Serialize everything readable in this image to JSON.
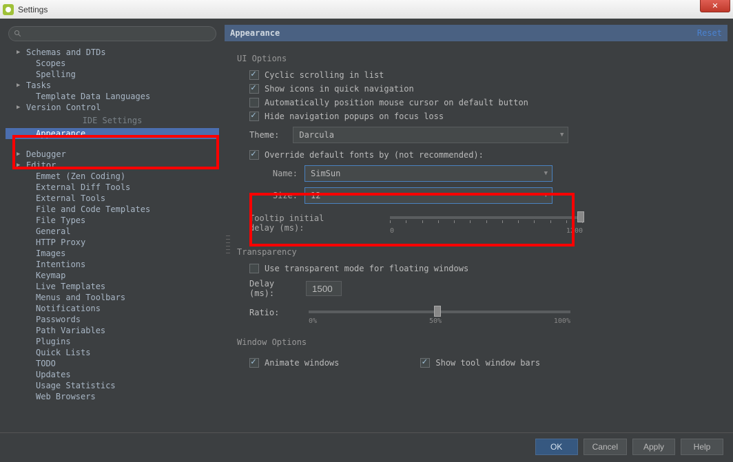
{
  "window": {
    "title": "Settings"
  },
  "sidebar": {
    "search_placeholder": "",
    "items_top": [
      {
        "label": "Schemas and DTDs",
        "expandable": true,
        "level": 0
      },
      {
        "label": "Scopes",
        "expandable": false,
        "level": 1
      },
      {
        "label": "Spelling",
        "expandable": false,
        "level": 1
      },
      {
        "label": "Tasks",
        "expandable": true,
        "level": 0
      },
      {
        "label": "Template Data Languages",
        "expandable": false,
        "level": 1
      },
      {
        "label": "Version Control",
        "expandable": true,
        "level": 0
      }
    ],
    "ide_section_label": "IDE Settings",
    "selected_item": "Appearance",
    "items_bottom": [
      {
        "label": "Debugger",
        "expandable": true,
        "level": 0
      },
      {
        "label": "Editor",
        "expandable": true,
        "level": 0
      },
      {
        "label": "Emmet (Zen Coding)",
        "expandable": false,
        "level": 1
      },
      {
        "label": "External Diff Tools",
        "expandable": false,
        "level": 1
      },
      {
        "label": "External Tools",
        "expandable": false,
        "level": 1
      },
      {
        "label": "File and Code Templates",
        "expandable": false,
        "level": 1
      },
      {
        "label": "File Types",
        "expandable": false,
        "level": 1
      },
      {
        "label": "General",
        "expandable": false,
        "level": 1
      },
      {
        "label": "HTTP Proxy",
        "expandable": false,
        "level": 1
      },
      {
        "label": "Images",
        "expandable": false,
        "level": 1
      },
      {
        "label": "Intentions",
        "expandable": false,
        "level": 1
      },
      {
        "label": "Keymap",
        "expandable": false,
        "level": 1
      },
      {
        "label": "Live Templates",
        "expandable": false,
        "level": 1
      },
      {
        "label": "Menus and Toolbars",
        "expandable": false,
        "level": 1
      },
      {
        "label": "Notifications",
        "expandable": false,
        "level": 1
      },
      {
        "label": "Passwords",
        "expandable": false,
        "level": 1
      },
      {
        "label": "Path Variables",
        "expandable": false,
        "level": 1
      },
      {
        "label": "Plugins",
        "expandable": false,
        "level": 1
      },
      {
        "label": "Quick Lists",
        "expandable": false,
        "level": 1
      },
      {
        "label": "TODO",
        "expandable": false,
        "level": 1
      },
      {
        "label": "Updates",
        "expandable": false,
        "level": 1
      },
      {
        "label": "Usage Statistics",
        "expandable": false,
        "level": 1
      },
      {
        "label": "Web Browsers",
        "expandable": false,
        "level": 1
      }
    ]
  },
  "main": {
    "title": "Appearance",
    "reset": "Reset",
    "ui_options_label": "UI Options",
    "opt_cyclic": "Cyclic scrolling in list",
    "opt_icons": "Show icons in quick navigation",
    "opt_auto_cursor": "Automatically position mouse cursor on default button",
    "opt_hide_popups": "Hide navigation popups on focus loss",
    "theme_label": "Theme:",
    "theme_value": "Darcula",
    "override_fonts": "Override default fonts by (not recommended):",
    "font_name_label": "Name:",
    "font_name_value": "SimSun",
    "font_size_label": "Size:",
    "font_size_value": "12",
    "tooltip_delay_label": "Tooltip initial delay (ms):",
    "tooltip_min": "0",
    "tooltip_max": "1200",
    "transparency_label": "Transparency",
    "opt_transparent": "Use transparent mode for floating windows",
    "delay_label": "Delay (ms):",
    "delay_value": "1500",
    "ratio_label": "Ratio:",
    "ratio_0": "0%",
    "ratio_50": "50%",
    "ratio_100": "100%",
    "window_options_label": "Window Options",
    "opt_animate": "Animate windows",
    "opt_toolwindow": "Show tool window bars"
  },
  "footer": {
    "ok": "OK",
    "cancel": "Cancel",
    "apply": "Apply",
    "help": "Help"
  }
}
